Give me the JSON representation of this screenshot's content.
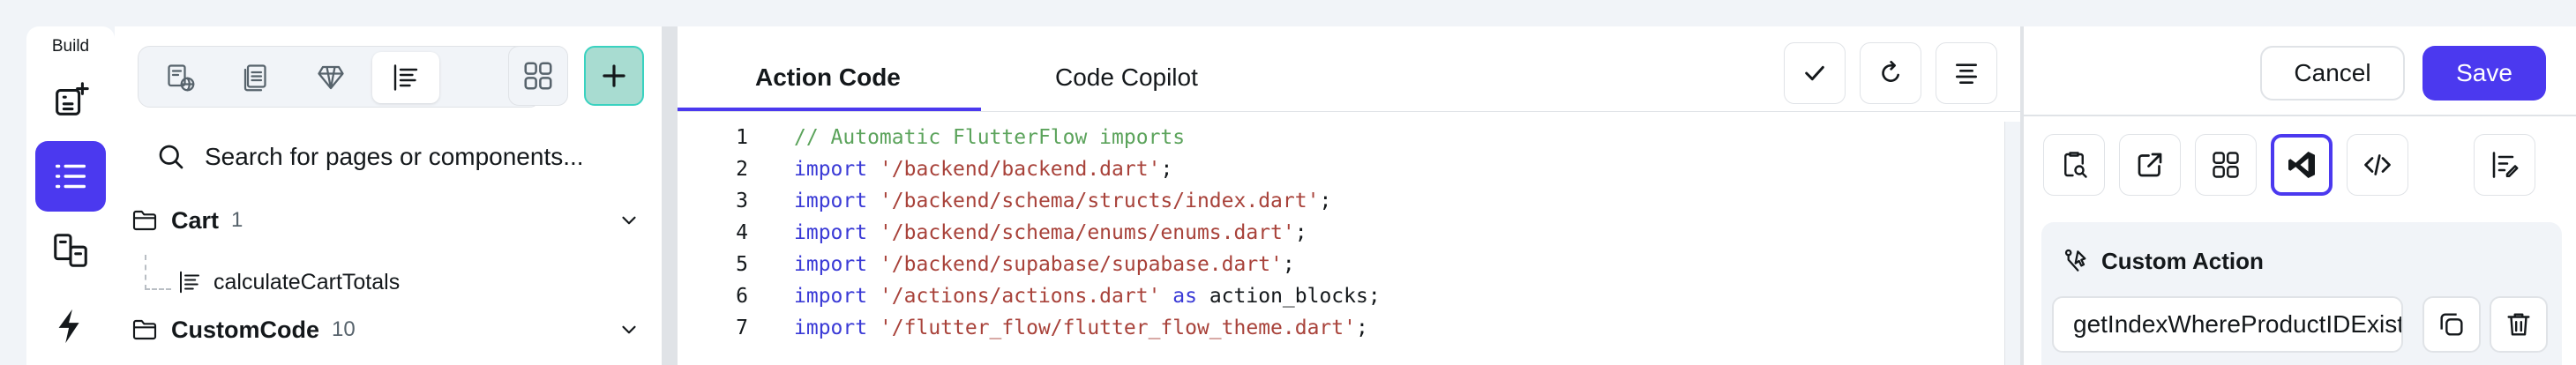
{
  "rail": {
    "label": "Build",
    "items": [
      {
        "icon": "add-page-icon",
        "active": false
      },
      {
        "icon": "list-tree-icon",
        "active": true
      },
      {
        "icon": "devices-icon",
        "active": false
      },
      {
        "icon": "lightning-icon",
        "active": false
      }
    ]
  },
  "tree": {
    "search_placeholder": "Search for pages or components...",
    "folders": [
      {
        "name": "Cart",
        "count": "1"
      },
      {
        "name": "CustomCode",
        "count": "10"
      }
    ],
    "child": {
      "name": "calculateCartTotals"
    }
  },
  "editor": {
    "tabs": [
      {
        "label": "Action Code",
        "active": true
      },
      {
        "label": "Code Copilot",
        "active": false
      }
    ],
    "lines": [
      {
        "n": "1",
        "tokens": [
          {
            "t": "// Automatic FlutterFlow imports",
            "c": "comment"
          }
        ]
      },
      {
        "n": "2",
        "tokens": [
          {
            "t": "import ",
            "c": "kw"
          },
          {
            "t": "'/backend/backend.dart'",
            "c": "str"
          },
          {
            "t": ";",
            "c": "plain"
          }
        ]
      },
      {
        "n": "3",
        "tokens": [
          {
            "t": "import ",
            "c": "kw"
          },
          {
            "t": "'/backend/schema/structs/index.dart'",
            "c": "str"
          },
          {
            "t": ";",
            "c": "plain"
          }
        ]
      },
      {
        "n": "4",
        "tokens": [
          {
            "t": "import ",
            "c": "kw"
          },
          {
            "t": "'/backend/schema/enums/enums.dart'",
            "c": "str"
          },
          {
            "t": ";",
            "c": "plain"
          }
        ]
      },
      {
        "n": "5",
        "tokens": [
          {
            "t": "import ",
            "c": "kw"
          },
          {
            "t": "'/backend/supabase/supabase.dart'",
            "c": "str"
          },
          {
            "t": ";",
            "c": "plain"
          }
        ]
      },
      {
        "n": "6",
        "tokens": [
          {
            "t": "import ",
            "c": "kw"
          },
          {
            "t": "'/actions/actions.dart'",
            "c": "str"
          },
          {
            "t": " as ",
            "c": "kw"
          },
          {
            "t": "action_blocks;",
            "c": "plain"
          }
        ]
      },
      {
        "n": "7",
        "tokens": [
          {
            "t": "import ",
            "c": "kw"
          },
          {
            "t": "'/flutter_flow/flutter_flow_theme.dart'",
            "c": "str"
          },
          {
            "t": ";",
            "c": "plain"
          }
        ]
      }
    ]
  },
  "right_panel": {
    "cancel_label": "Cancel",
    "save_label": "Save",
    "section_title": "Custom Action",
    "action_name": "getIndexWhereProductIDExists"
  },
  "colors": {
    "accent": "#4b39ef",
    "teal": "#39d2c0",
    "comment": "#5ba35b",
    "keyword": "#3a3ad6",
    "string": "#a8423a"
  }
}
